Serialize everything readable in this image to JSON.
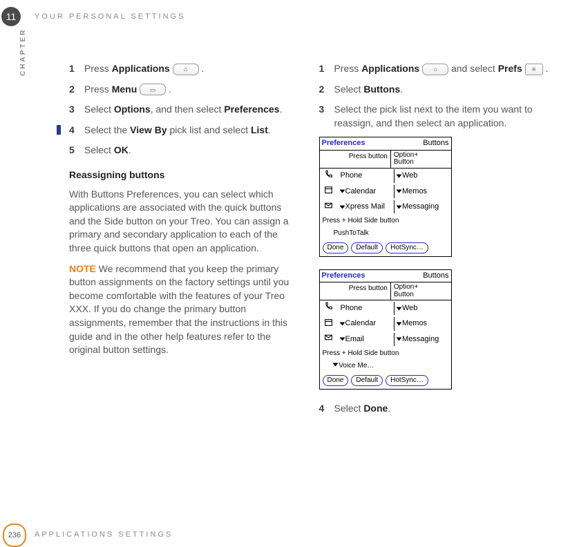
{
  "chapter": {
    "number": "11",
    "label": "CHAPTER",
    "title": "YOUR PERSONAL SETTINGS"
  },
  "footer": {
    "page": "236",
    "title": "APPLICATIONS SETTINGS"
  },
  "left": {
    "s1": {
      "n": "1",
      "a": "Press ",
      "b": "Applications",
      "c": "."
    },
    "s2": {
      "n": "2",
      "a": "Press ",
      "b": "Menu",
      "c": "."
    },
    "s3": {
      "n": "3",
      "a": "Select ",
      "b": "Options",
      "c": ", and then select ",
      "d": "Preferences",
      "e": "."
    },
    "s4": {
      "n": "4",
      "a": "Select the ",
      "b": "View By",
      "c": " pick list and select ",
      "d": "List",
      "e": "."
    },
    "s5": {
      "n": "5",
      "a": "Select ",
      "b": "OK",
      "c": "."
    },
    "head": "Reassigning buttons",
    "p1": "With Buttons Preferences, you can select which applications are associated with the quick buttons and the Side button on your Treo. You can assign a primary and secondary application to each of the three quick buttons that open an application.",
    "note_label": "NOTE",
    "note": " We recommend that you keep the primary button assignments on the factory settings until you become comfortable with the features of your Treo XXX. If you do change the primary button assignments, remember that the instructions in this guide and in the other help features refer to the original button settings."
  },
  "right": {
    "s1": {
      "n": "1",
      "a": "Press ",
      "b": "Applications",
      "c": " and select ",
      "d": "Prefs",
      "e": "."
    },
    "s2": {
      "n": "2",
      "a": "Select ",
      "b": "Buttons",
      "c": "."
    },
    "s3": {
      "n": "3",
      "a": "Select the pick list next to the item you want to reassign, and then select an application."
    },
    "s4": {
      "n": "4",
      "a": "Select ",
      "b": "Done",
      "c": "."
    }
  },
  "shot_common": {
    "title": "Preferences",
    "cat": "Buttons",
    "h1": "Press button",
    "h2": "Option+\nButton",
    "side": "Press + Hold Side button",
    "done": "Done",
    "default": "Default",
    "hotsync": "HotSync…"
  },
  "shot1": {
    "r1a": "Phone",
    "r1b": "Web",
    "r2a": "Calendar",
    "r2b": "Memos",
    "r3a": "Xpress Mail",
    "r3b": "Messaging",
    "side2": "PushToTalk"
  },
  "shot2": {
    "r1a": "Phone",
    "r1b": "Web",
    "r2a": "Calendar",
    "r2b": "Memos",
    "r3a": "Email",
    "r3b": "Messaging",
    "side2": "Voice Me…"
  }
}
